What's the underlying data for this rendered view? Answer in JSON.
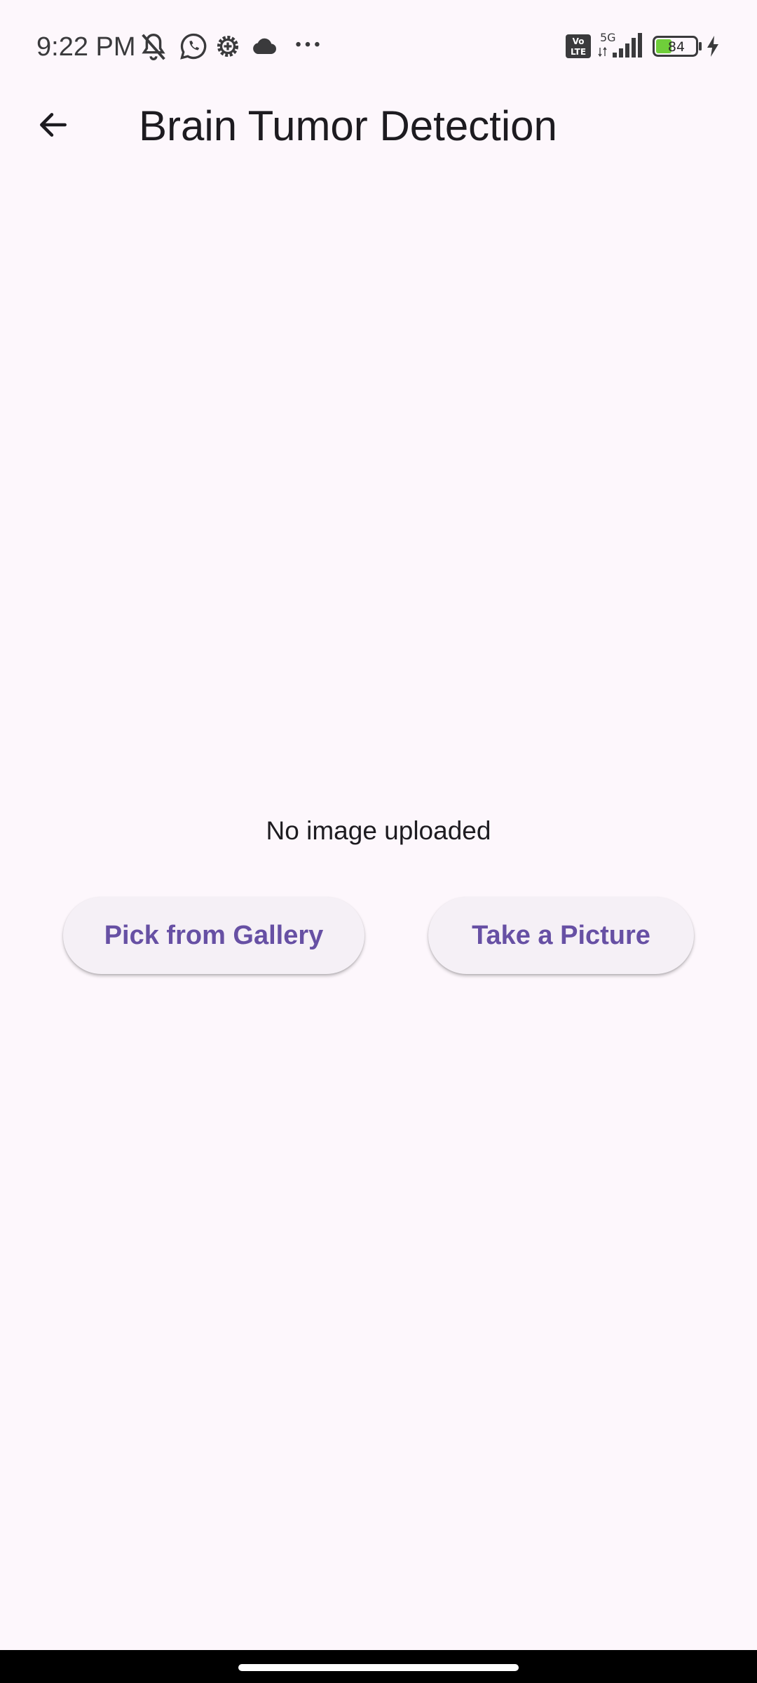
{
  "status_bar": {
    "time": "9:22 PM",
    "icons_left": [
      "mute-icon",
      "whatsapp-icon",
      "gear-icon",
      "cloud-icon",
      "more-dots-icon"
    ],
    "icons_right": [
      "volte-icon",
      "5g-signal-icon",
      "battery-icon",
      "charging-icon"
    ],
    "volte_line1": "Vo",
    "volte_line2": "LTE",
    "network": "5G",
    "battery_level": "84",
    "battery_color": "#6fce3a"
  },
  "app_bar": {
    "back_icon": "arrow-left-icon",
    "title": "Brain Tumor Detection"
  },
  "main": {
    "empty_message": "No image uploaded",
    "buttons": {
      "gallery_label": "Pick from Gallery",
      "camera_label": "Take a Picture"
    }
  },
  "theme": {
    "background": "#fdf7fc",
    "accent": "#6750a4",
    "button_bg": "#f5f0f6"
  }
}
